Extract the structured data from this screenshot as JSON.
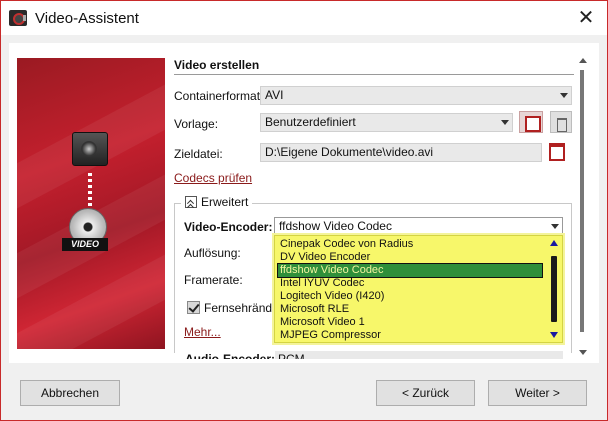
{
  "window": {
    "title": "Video-Assistent"
  },
  "section": {
    "title": "Video erstellen"
  },
  "container_format": {
    "label": "Containerformat:",
    "value": "AVI"
  },
  "preset": {
    "label": "Vorlage:",
    "value": "Benutzerdefiniert"
  },
  "target_file": {
    "label": "Zieldatei:",
    "value": "D:\\Eigene Dokumente\\video.avi"
  },
  "check_codecs_link": "Codecs prüfen",
  "advanced": {
    "toggle_label": "Erweitert",
    "video_encoder_label": "Video-Encoder:",
    "video_encoder_value": "ffdshow Video Codec",
    "resolution_label": "Auflösung:",
    "framerate_label": "Framerate:",
    "tv_borders_label": "Fernsehränder",
    "more_link": "Mehr...",
    "audio_encoder_label": "Audio-Encoder:",
    "audio_encoder_value": "PCM"
  },
  "encoder_options": [
    "Cinepak Codec von Radius",
    "DV Video Encoder",
    "ffdshow Video Codec",
    "Intel IYUV Codec",
    "Logitech Video (I420)",
    "Microsoft RLE",
    "Microsoft Video 1",
    "MJPEG Compressor"
  ],
  "encoder_selected_index": 2,
  "side_image": {
    "badge": "VIDEO"
  },
  "buttons": {
    "cancel": "Abbrechen",
    "back": "< Zurück",
    "next": "Weiter >"
  },
  "colors": {
    "accent": "#c82a2a",
    "highlight": "#f7f76a",
    "selected": "#2f8f3a"
  }
}
